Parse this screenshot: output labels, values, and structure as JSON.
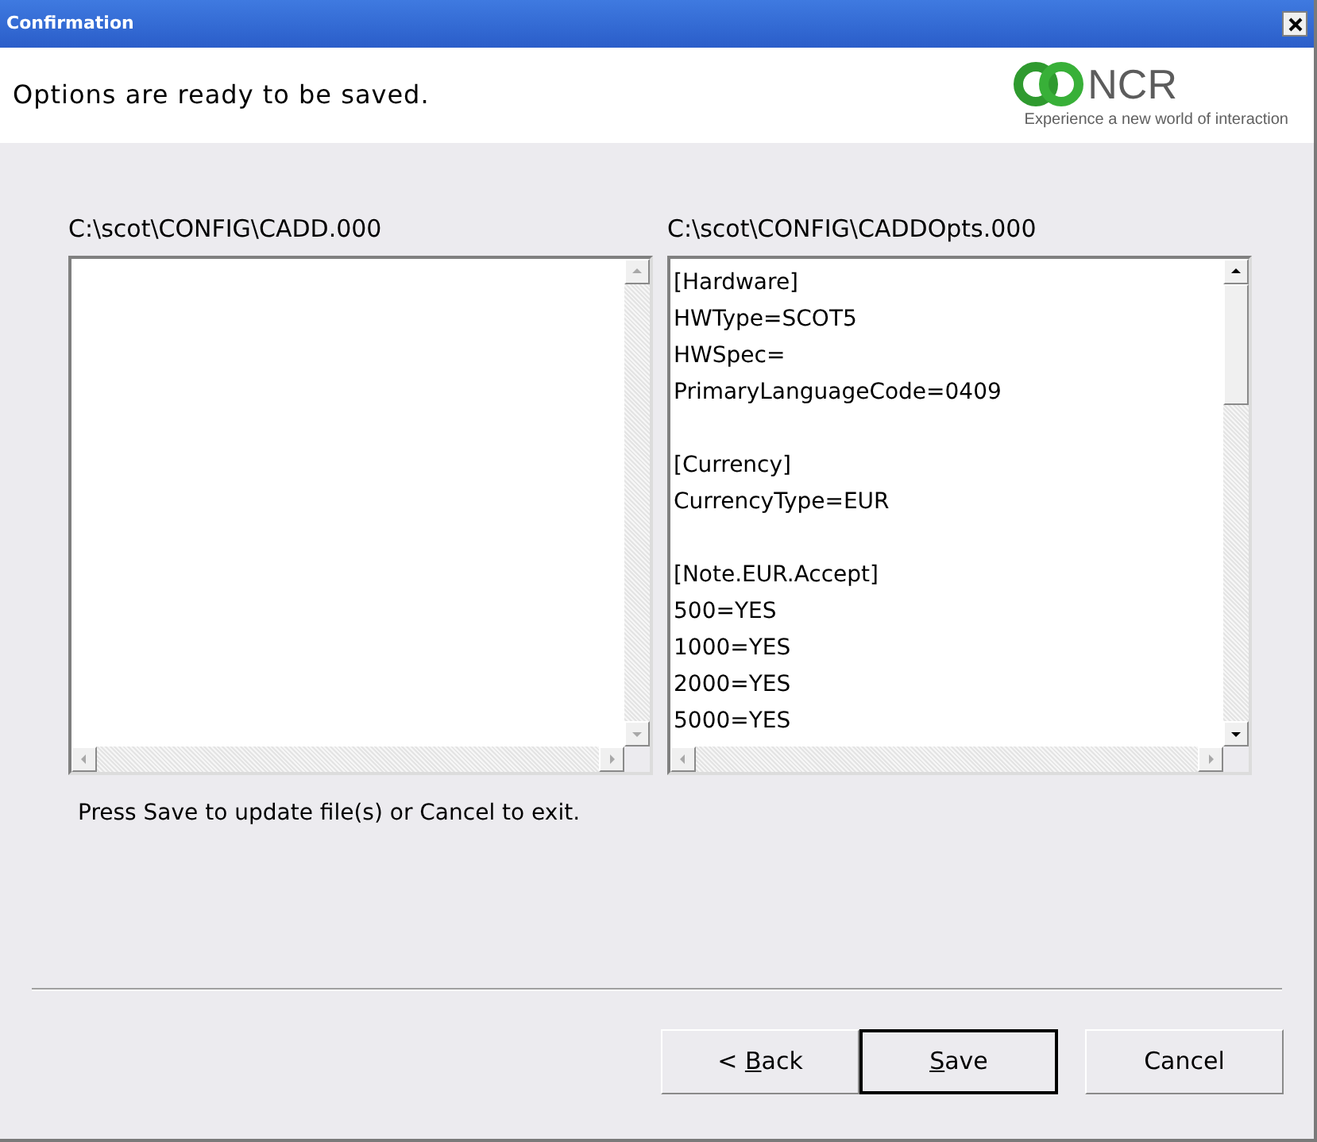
{
  "window": {
    "title": "Confirmation"
  },
  "header": {
    "message": "Options are ready to be saved.",
    "logo": {
      "name": "NCR",
      "tagline": "Experience a new world of interaction"
    }
  },
  "panes": [
    {
      "path": "C:\\scot\\CONFIG\\CADD.000",
      "enabled": false
    },
    {
      "path": "C:\\scot\\CONFIG\\CADDOpts.000",
      "enabled": true,
      "sections": [
        {
          "lines": [
            "[Hardware]",
            "HWType=SCOT5",
            "HWSpec=",
            "PrimaryLanguageCode=0409"
          ]
        },
        {
          "lines": [
            "[Currency]",
            "CurrencyType=EUR"
          ]
        },
        {
          "lines": [
            "[Note.EUR.Accept]",
            "500=YES",
            "1000=YES",
            "2000=YES",
            "5000=YES"
          ]
        }
      ]
    }
  ],
  "hint": "Press Save to update file(s) or Cancel to exit.",
  "buttons": [
    {
      "before": "< ",
      "mnemonic": "B",
      "after": "ack",
      "default": false
    },
    {
      "mnemonic": "S",
      "after": "ave",
      "default": true
    },
    {
      "after": "Cancel",
      "default": false
    }
  ]
}
